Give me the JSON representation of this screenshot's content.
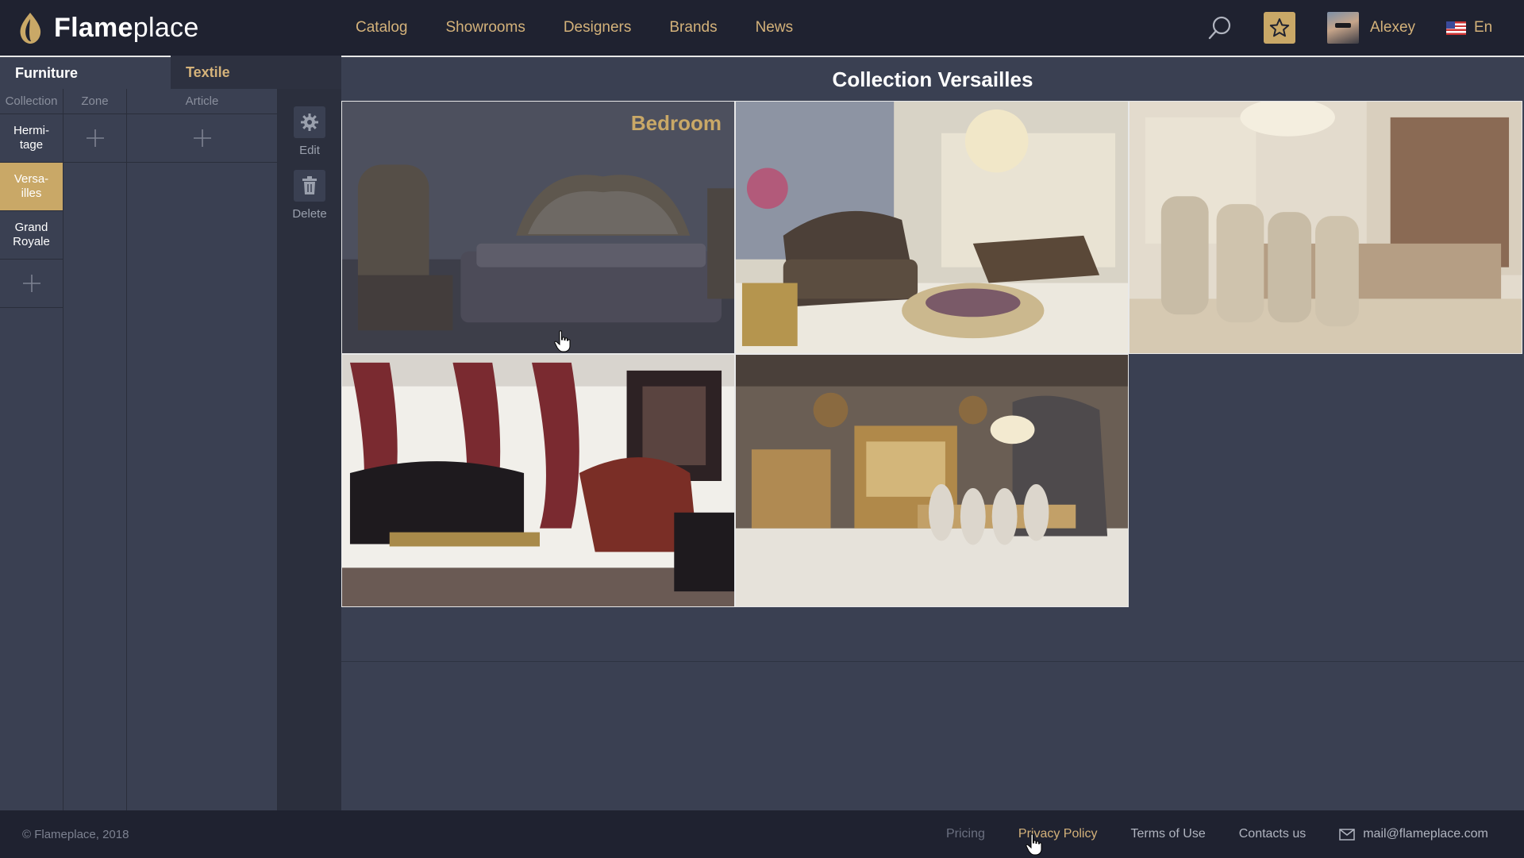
{
  "brand": {
    "bold": "Flame",
    "light": "place"
  },
  "nav": {
    "catalog": "Catalog",
    "showrooms": "Showrooms",
    "designers": "Designers",
    "brands": "Brands",
    "news": "News"
  },
  "header": {
    "search_icon": "search-icon",
    "favorites_icon": "star-icon",
    "user_name": "Alexey",
    "language": "En",
    "accent_color": "#c9a867"
  },
  "sidebar": {
    "tabs": [
      "Furniture",
      "Textile"
    ],
    "active_tab": "Furniture",
    "columns": {
      "collection": "Collection",
      "zone": "Zone",
      "article": "Article"
    },
    "collections": [
      {
        "label_l1": "Hermi-",
        "label_l2": "tage",
        "active": false
      },
      {
        "label_l1": "Versa-",
        "label_l2": "illes",
        "active": true
      },
      {
        "label_l1": "Grand",
        "label_l2": "Royale",
        "active": false
      }
    ],
    "tools": {
      "edit": "Edit",
      "delete": "Delete"
    }
  },
  "main": {
    "title": "Collection Versailles",
    "tiles": [
      {
        "label": "Bedroom",
        "hovered": true,
        "icon": "bedroom-photo"
      },
      {
        "label": "",
        "hovered": false,
        "icon": "living-room-photo"
      },
      {
        "label": "",
        "hovered": false,
        "icon": "dining-room-photo"
      },
      {
        "label": "",
        "hovered": false,
        "icon": "study-photo"
      },
      {
        "label": "",
        "hovered": false,
        "icon": "dining-hall-photo"
      }
    ]
  },
  "footer": {
    "copyright": "© Flameplace, 2018",
    "links": {
      "pricing": "Pricing",
      "privacy": "Privacy Policy",
      "terms": "Terms of Use",
      "contacts": "Contacts us"
    },
    "email": "mail@flameplace.com"
  }
}
